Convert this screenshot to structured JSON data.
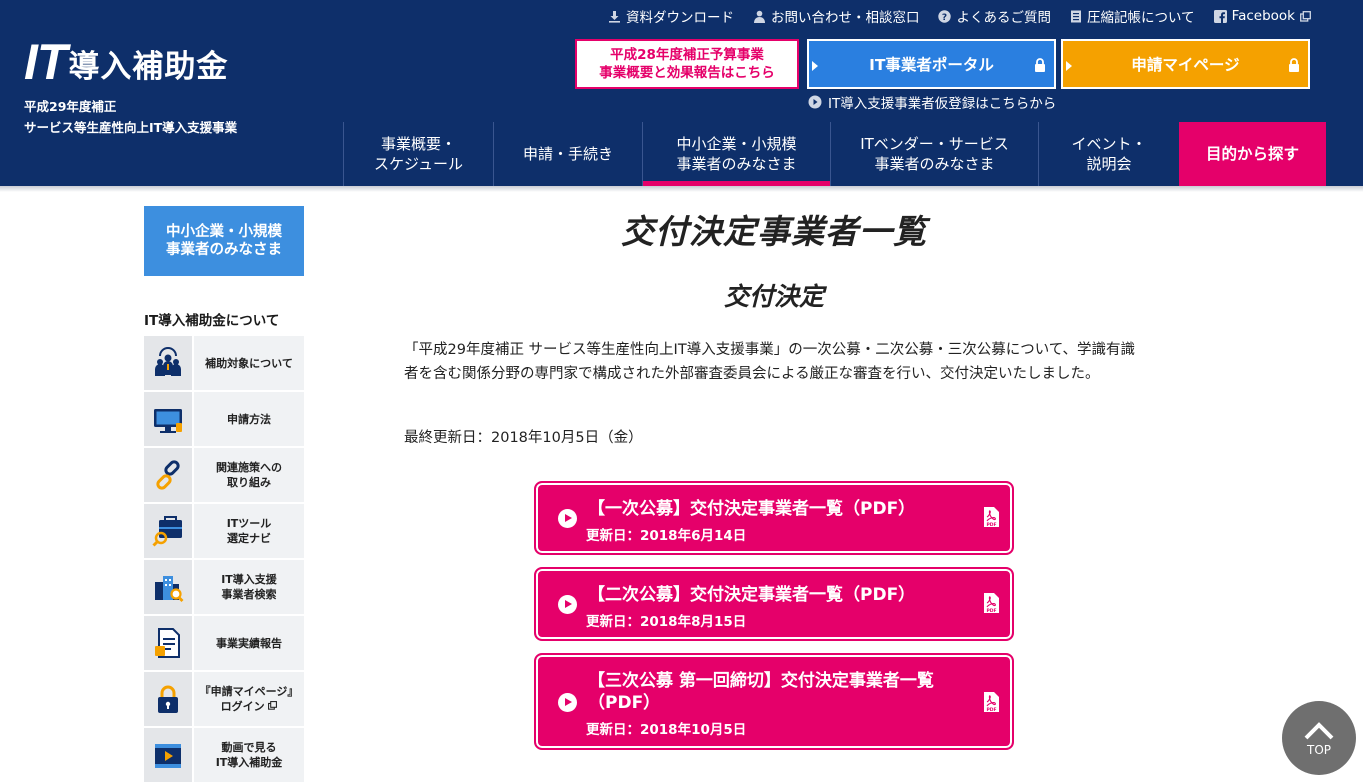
{
  "header": {
    "logo_it": "IT",
    "logo_jp": "導入補助金",
    "logo_sub1": "平成29年度補正",
    "logo_sub2": "サービス等生産性向上IT導入支援事業",
    "util": {
      "download": "資料ダウンロード",
      "contact": "お問い合わせ・相談窓口",
      "faq": "よくあるご質問",
      "ledger": "圧縮記帳について",
      "facebook": "Facebook"
    },
    "h28_line1": "平成28年度補正予算事業",
    "h28_line2": "事業概要と効果報告はこちら",
    "portal": "IT事業者ポータル",
    "mypage": "申請マイページ",
    "prereg": "IT導入支援事業者仮登録はこちらから",
    "nav": [
      {
        "l1": "事業概要・",
        "l2": "スケジュール"
      },
      {
        "l1": "申請・手続き",
        "l2": ""
      },
      {
        "l1": "中小企業・小規模",
        "l2": "事業者のみなさま"
      },
      {
        "l1": "ITベンダー・サービス",
        "l2": "事業者のみなさま"
      },
      {
        "l1": "イベント・",
        "l2": "説明会"
      },
      {
        "l1": "目的から探す",
        "l2": ""
      }
    ]
  },
  "sidebar": {
    "head_l1": "中小企業・小規模",
    "head_l2": "事業者のみなさま",
    "title": "IT導入補助金について",
    "items": [
      {
        "l1": "補助対象について",
        "l2": "",
        "icon": "people-icon"
      },
      {
        "l1": "申請方法",
        "l2": "",
        "icon": "monitor-icon"
      },
      {
        "l1": "関連施策への",
        "l2": "取り組み",
        "icon": "link-icon"
      },
      {
        "l1": "ITツール",
        "l2": "選定ナビ",
        "icon": "toolbox-search-icon"
      },
      {
        "l1": "IT導入支援",
        "l2": "事業者検索",
        "icon": "building-search-icon"
      },
      {
        "l1": "事業実績報告",
        "l2": "",
        "icon": "report-icon"
      },
      {
        "l1": "『申請マイページ』",
        "l2": "ログイン",
        "icon": "lock-icon"
      },
      {
        "l1": "動画で見る",
        "l2": "IT導入補助金",
        "icon": "video-icon"
      }
    ]
  },
  "main": {
    "title": "交付決定事業者一覧",
    "subtitle": "交付決定",
    "intro": "「平成29年度補正 サービス等生産性向上IT導入支援事業」の一次公募・二次公募・三次公募について、学識有識者を含む関係分野の専門家で構成された外部審査委員会による厳正な審査を行い、交付決定いたしました。",
    "updated": "最終更新日：2018年10月5日（金）",
    "pdfs": [
      {
        "title": "【一次公募】交付決定事業者一覧（PDF）",
        "date": "更新日：2018年6月14日"
      },
      {
        "title": "【二次公募】交付決定事業者一覧（PDF）",
        "date": "更新日：2018年8月15日"
      },
      {
        "title": "【三次公募 第一回締切】交付決定事業者一覧（PDF）",
        "date": "更新日：2018年10月5日"
      }
    ],
    "pdf_icon_text": "PDF"
  },
  "top_button": "TOP",
  "colors": {
    "navy": "#0e2f6a",
    "pink": "#e5006a",
    "blue": "#2a7fe0",
    "orange": "#f5a100",
    "sidebar_blue": "#3d8fdf"
  }
}
